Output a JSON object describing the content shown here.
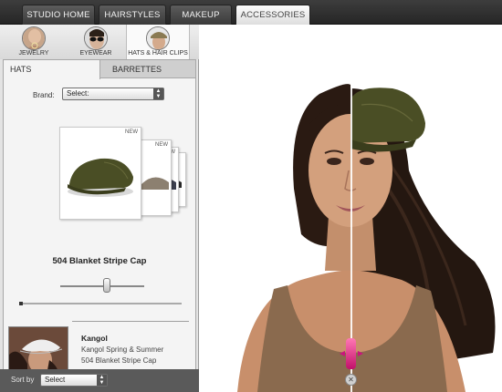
{
  "top_tabs": [
    {
      "label": "STUDIO HOME",
      "active": false
    },
    {
      "label": "HAIRSTYLES",
      "active": false
    },
    {
      "label": "MAKEUP",
      "active": false
    },
    {
      "label": "ACCESSORIES",
      "active": true
    }
  ],
  "categories": [
    {
      "label": "JEWELRY",
      "icon": "jewelry-thumbnail-icon"
    },
    {
      "label": "EYEWEAR",
      "icon": "eyewear-thumbnail-icon"
    },
    {
      "label": "HATS & HAIR CLIPS",
      "icon": "hats-thumbnail-icon",
      "active": true
    }
  ],
  "sub_tabs": [
    {
      "label": "HATS",
      "active": true
    },
    {
      "label": "BARRETTES",
      "active": false
    }
  ],
  "brand_filter": {
    "label": "Brand:",
    "value": "Select:"
  },
  "gallery": {
    "new_badge": "NEW",
    "selected_item": "504 Blanket Stripe Cap",
    "slider_level": 0.55
  },
  "promo": {
    "brand": "Kangol",
    "line1": "Kangol Spring & Summer",
    "line2": "504 Blanket Stripe Cap"
  },
  "sort": {
    "label": "Sort by",
    "value": "Select"
  },
  "colors": {
    "hat_olive": "#4a4e25",
    "accent_pink": "#d5177f"
  }
}
